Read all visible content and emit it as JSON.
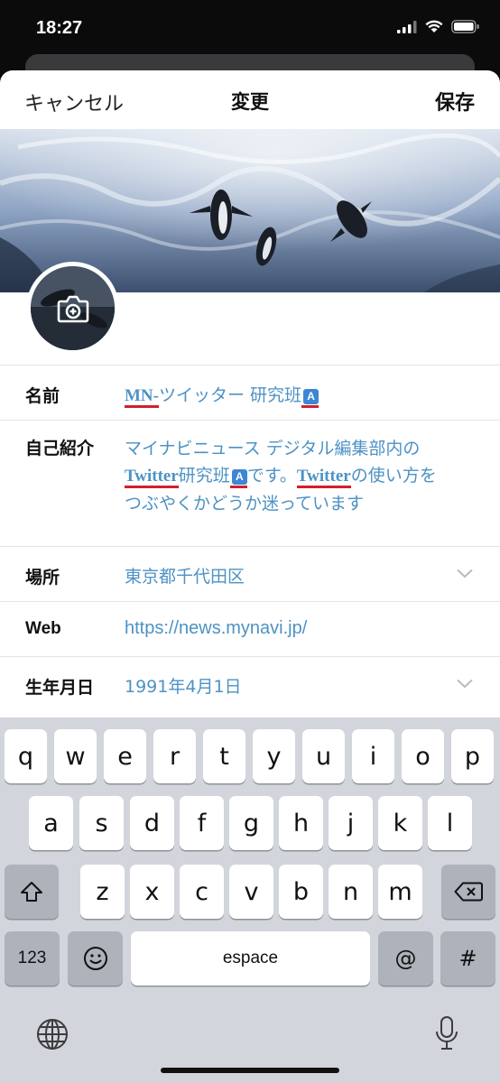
{
  "status": {
    "time": "18:27",
    "icons": [
      "signal-icon",
      "wifi-icon",
      "battery-icon"
    ]
  },
  "nav": {
    "cancel": "キャンセル",
    "title": "変更",
    "save": "保存"
  },
  "profile": {
    "banner_icon": "penguin-banner-image",
    "avatar_icon": "camera-plus-icon"
  },
  "fields": {
    "name": {
      "label": "名前",
      "value_part1": "MN-",
      "value_part2": "ツイッター 研究班"
    },
    "bio": {
      "label": "自己紹介",
      "line1": "マイナビニュース デジタル編集部内の",
      "line2_a": "Twitter",
      "line2_b": "研究班",
      "line2_c": "です。",
      "line2_d": "Twitter",
      "line2_e": "の使い方を",
      "line3": "つぶやくかどうか迷っています"
    },
    "location": {
      "label": "場所",
      "value": "東京都千代田区"
    },
    "web": {
      "label": "Web",
      "value": "https://news.mynavi.jp/"
    },
    "birthday": {
      "label": "生年月日",
      "value": "1991年4月1日"
    }
  },
  "keyboard": {
    "row1": [
      "q",
      "w",
      "e",
      "r",
      "t",
      "y",
      "u",
      "i",
      "o",
      "p"
    ],
    "row2": [
      "a",
      "s",
      "d",
      "f",
      "g",
      "h",
      "j",
      "k",
      "l"
    ],
    "row3": [
      "z",
      "x",
      "c",
      "v",
      "b",
      "n",
      "m"
    ],
    "numbers": "123",
    "space": "espace",
    "at": "@",
    "hash": "#"
  },
  "colors": {
    "accent": "#4d92c4",
    "underline": "#d0202c",
    "tag": "#3d86d6"
  }
}
